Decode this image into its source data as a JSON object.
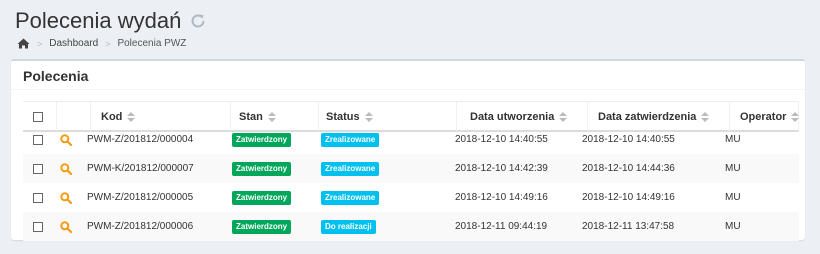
{
  "page": {
    "title": "Polecenia wydań"
  },
  "breadcrumb": {
    "items": [
      "Dashboard",
      "Polecenia PWZ"
    ]
  },
  "box": {
    "title": "Polecenia"
  },
  "table": {
    "columns": [
      "Kod",
      "Stan",
      "Status",
      "Data utworzenia",
      "Data zatwierdzenia",
      "Operator"
    ],
    "rows": [
      {
        "kod": "PWM-Z/201812/000004",
        "stan": "Zatwierdzony",
        "status": "Zrealizowane",
        "utworzenia": "2018-12-10 14:40:55",
        "zatwierdzenia": "2018-12-10 14:40:55",
        "operator": "MU"
      },
      {
        "kod": "PWM-K/201812/000007",
        "stan": "Zatwierdzony",
        "status": "Zrealizowane",
        "utworzenia": "2018-12-10 14:42:39",
        "zatwierdzenia": "2018-12-10 14:44:36",
        "operator": "MU"
      },
      {
        "kod": "PWM-Z/201812/000005",
        "stan": "Zatwierdzony",
        "status": "Zrealizowane",
        "utworzenia": "2018-12-10 14:49:16",
        "zatwierdzenia": "2018-12-10 14:49:16",
        "operator": "MU"
      },
      {
        "kod": "PWM-Z/201812/000006",
        "stan": "Zatwierdzony",
        "status": "Do realizacji",
        "utworzenia": "2018-12-11 09:44:19",
        "zatwierdzenia": "2018-12-11 13:47:58",
        "operator": "MU"
      }
    ]
  },
  "colors": {
    "badge_green": "#00a65a",
    "badge_cyan": "#00c0ef",
    "magnifier": "#f39c12"
  }
}
